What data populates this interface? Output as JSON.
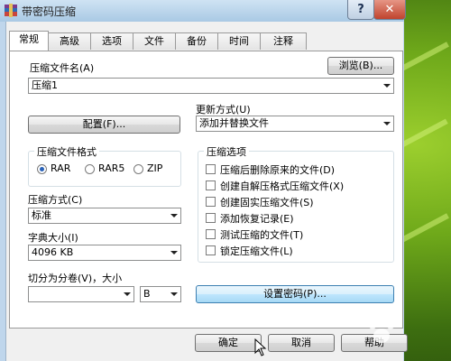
{
  "window": {
    "title": "带密码压缩",
    "help_glyph": "?",
    "close_glyph": "✕"
  },
  "tabs": [
    {
      "label": "常规",
      "active": true
    },
    {
      "label": "高级"
    },
    {
      "label": "选项"
    },
    {
      "label": "文件"
    },
    {
      "label": "备份"
    },
    {
      "label": "时间"
    },
    {
      "label": "注释"
    }
  ],
  "archive_name": {
    "label": "压缩文件名(A)",
    "value": "压缩1",
    "browse_label": "浏览(B)..."
  },
  "update_mode": {
    "label": "更新方式(U)",
    "value": "添加并替换文件"
  },
  "profiles_button": "配置(F)...",
  "format": {
    "title": "压缩文件格式",
    "options": [
      "RAR",
      "RAR5",
      "ZIP"
    ],
    "selected": "RAR"
  },
  "options_group": {
    "title": "压缩选项",
    "items": [
      {
        "label": "压缩后删除原来的文件(D)",
        "checked": false
      },
      {
        "label": "创建自解压格式压缩文件(X)",
        "checked": false
      },
      {
        "label": "创建固实压缩文件(S)",
        "checked": false
      },
      {
        "label": "添加恢复记录(E)",
        "checked": false
      },
      {
        "label": "测试压缩的文件(T)",
        "checked": false
      },
      {
        "label": "锁定压缩文件(L)",
        "checked": false
      }
    ]
  },
  "method": {
    "label": "压缩方式(C)",
    "value": "标准"
  },
  "dictionary": {
    "label": "字典大小(I)",
    "value": "4096 KB"
  },
  "split": {
    "label": "切分为分卷(V)，大小",
    "value": "",
    "unit": "B"
  },
  "set_password_button": "设置密码(P)...",
  "footer": {
    "ok": "确定",
    "cancel": "取消",
    "help": "帮助"
  },
  "watermark": "Bai 经验"
}
